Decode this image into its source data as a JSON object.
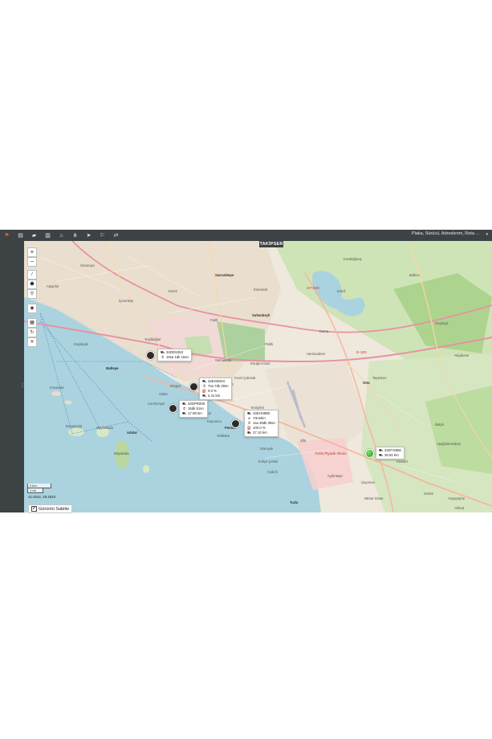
{
  "toolbar": {
    "icons": [
      "flag-icon",
      "document-icon",
      "folder-icon",
      "report-icon",
      "graduation-cap-icon",
      "network-icon",
      "navigation-icon",
      "signpost-icon",
      "settings-icon"
    ],
    "search_text": "Plaka, Sürücü, Adreslerim, Rota ...",
    "dropdown_glyph": "▾"
  },
  "brand": {
    "title": "TAKİPSER"
  },
  "map_controls": {
    "zoom_in": "+",
    "zoom_out": "−",
    "tools": [
      "/",
      "⬟",
      "⚲"
    ],
    "extra": [
      "◉",
      "▦",
      "↻",
      "✕"
    ]
  },
  "places": [
    {
      "name": "Kartal",
      "cls": "dark"
    },
    {
      "name": "Maltepe",
      "cls": "dark"
    },
    {
      "name": "Sancaktepe",
      "cls": "dark"
    },
    {
      "name": "Sultanbeyli",
      "cls": "dark"
    },
    {
      "name": "Pendik",
      "cls": "dark"
    },
    {
      "name": "Tuzla",
      "cls": "dark"
    },
    {
      "name": "Orta",
      "cls": "dark"
    },
    {
      "name": "Akfırat",
      "cls": ""
    },
    {
      "name": "Çayırova",
      "cls": ""
    },
    {
      "name": "Gebze",
      "cls": ""
    },
    {
      "name": "Aydınlı",
      "cls": ""
    },
    {
      "name": "Tuzla Piyade Okulu",
      "cls": "red"
    },
    {
      "name": "Dragos",
      "cls": ""
    },
    {
      "name": "Kınalıada",
      "cls": ""
    },
    {
      "name": "Burgazada",
      "cls": ""
    },
    {
      "name": "Heybeliada",
      "cls": ""
    },
    {
      "name": "Büyükada",
      "cls": ""
    },
    {
      "name": "Adalar",
      "cls": "dark"
    },
    {
      "name": "Ataşehir",
      "cls": ""
    },
    {
      "name": "Ümraniye",
      "cls": ""
    },
    {
      "name": "Samandıra",
      "cls": ""
    },
    {
      "name": "Kurtdoğmuş",
      "cls": ""
    },
    {
      "name": "Emirli",
      "cls": ""
    },
    {
      "name": "Ballıca",
      "cls": ""
    },
    {
      "name": "Göçbeyli",
      "cls": ""
    },
    {
      "name": "Akçakese",
      "cls": ""
    },
    {
      "name": "Tepeören",
      "cls": ""
    },
    {
      "name": "Balçık",
      "cls": ""
    },
    {
      "name": "Aşağıhamzabey",
      "cls": ""
    },
    {
      "name": "Kavaklı",
      "cls": ""
    },
    {
      "name": "Mimar Sinan",
      "cls": ""
    },
    {
      "name": "Kurna",
      "cls": ""
    },
    {
      "name": "Harmandere",
      "cls": ""
    },
    {
      "name": "Fevzi Çakmak",
      "cls": ""
    },
    {
      "name": "Yenişehir",
      "cls": ""
    },
    {
      "name": "Ertuğrul Gazi",
      "cls": ""
    },
    {
      "name": "Hürriyet",
      "cls": ""
    },
    {
      "name": "Esenyalı",
      "cls": ""
    },
    {
      "name": "Şifa",
      "cls": ""
    },
    {
      "name": "Evliya Çelebi",
      "cls": ""
    },
    {
      "name": "Aydıntepe",
      "cls": ""
    },
    {
      "name": "Küçükyalı",
      "cls": ""
    },
    {
      "name": "İçerenköy",
      "cls": ""
    },
    {
      "name": "Yeşilbağlar",
      "cls": ""
    },
    {
      "name": "Gümüşpınar",
      "cls": ""
    },
    {
      "name": "Fatih",
      "cls": ""
    },
    {
      "name": "Emek",
      "cls": ""
    },
    {
      "name": "Esenkent",
      "cls": ""
    },
    {
      "name": "Atalar",
      "cls": ""
    },
    {
      "name": "Cumhuriyet",
      "cls": ""
    },
    {
      "name": "Kaynarca",
      "cls": ""
    },
    {
      "name": "Velibaba",
      "cls": ""
    },
    {
      "name": "Arapçeşme",
      "cls": ""
    },
    {
      "name": "Pelitli",
      "cls": ""
    },
    {
      "name": "O7-E80",
      "cls": "red"
    },
    {
      "name": "D-100",
      "cls": "red"
    }
  ],
  "vehicles": [
    {
      "plate": "34DDS263",
      "lines": [
        {
          "icon": "⏱",
          "text": "19sa 1dk 16sn"
        }
      ],
      "color": "dark"
    },
    {
      "plate": "34EGB204",
      "lines": [
        {
          "icon": "⏱",
          "text": "7sa 7dk 29sn"
        },
        {
          "icon": "⛽",
          "text": "0.0 %"
        },
        {
          "icon": "⛟",
          "text": "4.41 km"
        }
      ],
      "color": "dark"
    },
    {
      "plate": "34DPR008",
      "lines": [
        {
          "icon": "⏱",
          "text": "16dk 51sn"
        },
        {
          "icon": "⛟",
          "text": "17.09 km"
        }
      ],
      "color": "dark"
    },
    {
      "plate": "34EHH985",
      "lines": [
        {
          "icon": "➤",
          "text": "Yönetim"
        },
        {
          "icon": "⏱",
          "text": "1sa 30dk 39sn"
        },
        {
          "icon": "⛽",
          "text": "100.0 %"
        },
        {
          "icon": "⛟",
          "text": "27.10 km"
        }
      ],
      "color": "dark"
    },
    {
      "plate": "34DYS856",
      "lines": [
        {
          "icon": "⛟",
          "text": "35.91 km"
        }
      ],
      "color": "green"
    }
  ],
  "scale": {
    "km": "2 km",
    "mi": "1 mi"
  },
  "coords": "41.0242, 29.2923",
  "sticky": {
    "label": "Görüntü Sabitle",
    "checked": "✔"
  }
}
